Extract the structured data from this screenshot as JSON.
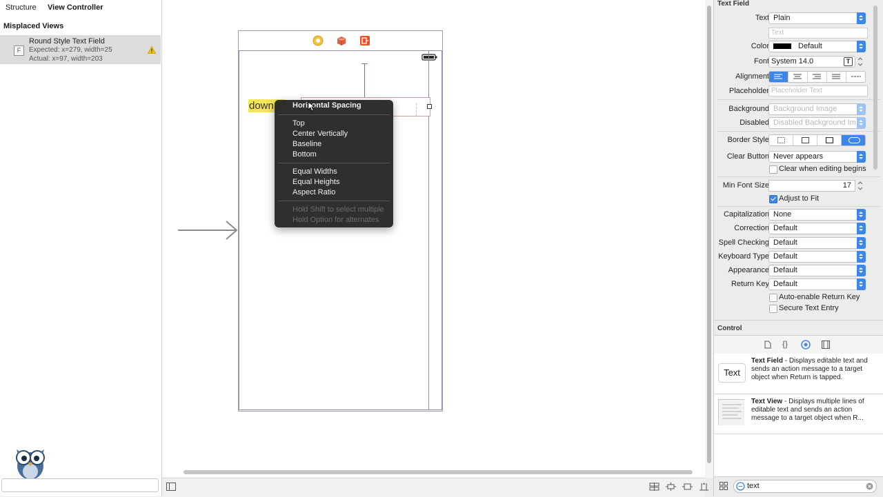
{
  "navigator": {
    "tab_structure": "Structure",
    "tab_view_controller": "View Controller",
    "section_title": "Misplaced Views",
    "issue": {
      "icon_letter": "F",
      "title": "Round Style Text Field",
      "expected": "Expected: x=279, width=25",
      "actual": "Actual: x=97, width=203"
    }
  },
  "canvas": {
    "label_text": "down"
  },
  "context_menu": {
    "items_group1": [
      "Horizontal Spacing"
    ],
    "items_group2": [
      "Top",
      "Center Vertically",
      "Baseline",
      "Bottom"
    ],
    "items_group3": [
      "Equal Widths",
      "Equal Heights",
      "Aspect Ratio"
    ],
    "hint1": "Hold Shift to select multiple",
    "hint2": "Hold Option for alternates"
  },
  "inspector": {
    "section_text_field": "Text Field",
    "text_label": "Text",
    "text_value": "Plain",
    "text_placeholder": "Text",
    "color_label": "Color",
    "color_value": "Default",
    "font_label": "Font",
    "font_value": "System 14.0",
    "alignment_label": "Alignment",
    "placeholder_label": "Placeholder",
    "placeholder_placeholder": "Placeholder Text",
    "background_label": "Background",
    "background_value": "Background Image",
    "disabled_label": "Disabled",
    "disabled_value": "Disabled Background Im",
    "border_style_label": "Border Style",
    "clear_button_label": "Clear Button",
    "clear_button_value": "Never appears",
    "clear_when_editing": "Clear when editing begins",
    "min_font_size_label": "Min Font Size",
    "min_font_size_value": "17",
    "adjust_to_fit": "Adjust to Fit",
    "capitalization_label": "Capitalization",
    "capitalization_value": "None",
    "correction_label": "Correction",
    "correction_value": "Default",
    "spell_checking_label": "Spell Checking",
    "spell_checking_value": "Default",
    "keyboard_type_label": "Keyboard Type",
    "keyboard_type_value": "Default",
    "appearance_label": "Appearance",
    "appearance_value": "Default",
    "return_key_label": "Return Key",
    "return_key_value": "Default",
    "auto_enable": "Auto-enable Return Key",
    "secure_text": "Secure Text Entry",
    "section_control": "Control"
  },
  "library": {
    "items": [
      {
        "thumb": "Text",
        "name": "Text Field",
        "desc": " - Displays editable text and sends an action message to a target object when Return is tapped."
      },
      {
        "name": "Text View",
        "desc": " - Displays multiple lines of editable text and sends an action message to a target object when R..."
      }
    ],
    "filter_value": "text"
  },
  "colors": {
    "accent": "#3d86e8",
    "label_highlight": "#f5e657",
    "menu_bg": "#262626"
  }
}
